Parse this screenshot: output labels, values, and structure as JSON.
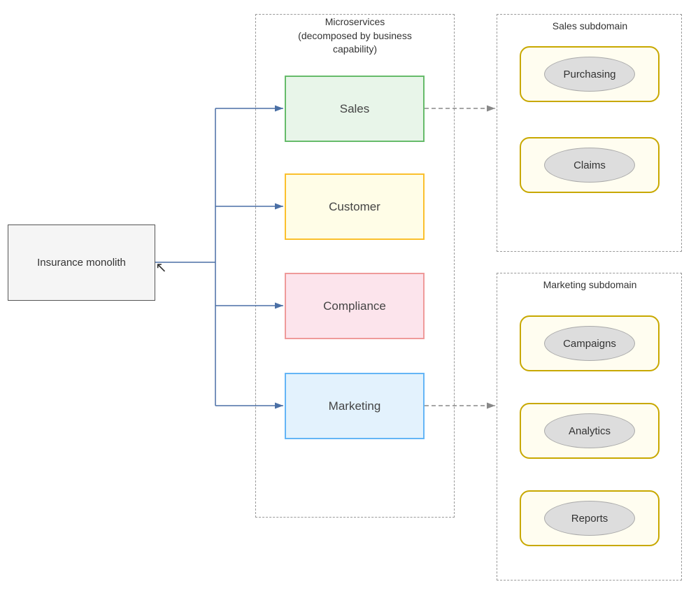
{
  "monolith": {
    "label": "Insurance monolith"
  },
  "microservices": {
    "title_line1": "Microservices",
    "title_line2": "(decomposed by business",
    "title_line3": "capability)",
    "services": [
      {
        "id": "sales",
        "label": "Sales"
      },
      {
        "id": "customer",
        "label": "Customer"
      },
      {
        "id": "compliance",
        "label": "Compliance"
      },
      {
        "id": "marketing",
        "label": "Marketing"
      }
    ]
  },
  "sales_subdomain": {
    "title": "Sales subdomain",
    "items": [
      {
        "id": "purchasing",
        "label": "Purchasing"
      },
      {
        "id": "claims",
        "label": "Claims"
      }
    ]
  },
  "marketing_subdomain": {
    "title": "Marketing subdomain",
    "items": [
      {
        "id": "campaigns",
        "label": "Campaigns"
      },
      {
        "id": "analytics",
        "label": "Analytics"
      },
      {
        "id": "reports",
        "label": "Reports"
      }
    ]
  }
}
